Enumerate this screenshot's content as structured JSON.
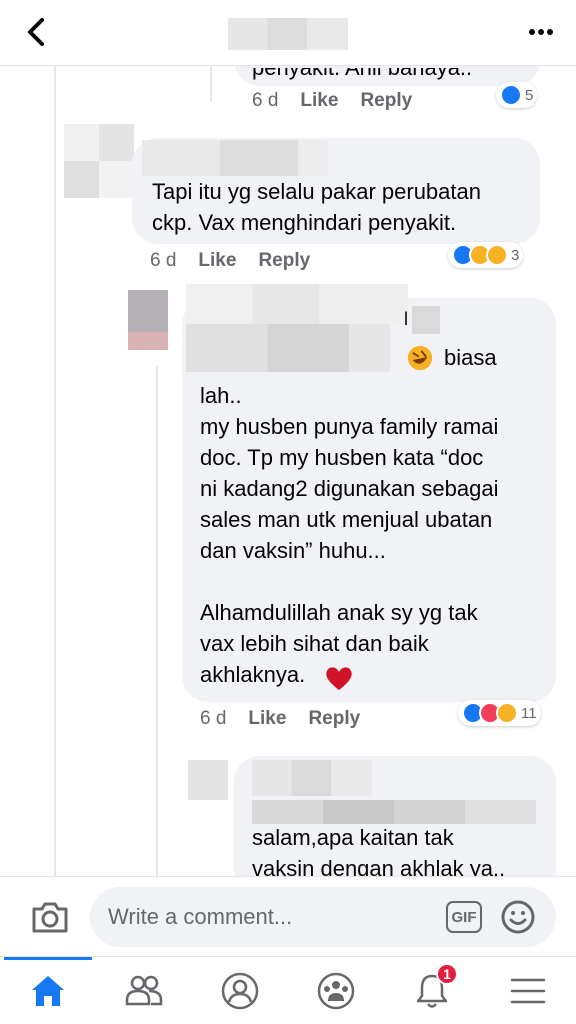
{
  "comments": [
    {
      "text_partial": "penyakit. Ahli bahaya..",
      "time": "6 d",
      "like_label": "Like",
      "reply_label": "Reply",
      "reactions": [
        "like"
      ],
      "reaction_count": "5"
    },
    {
      "text": "Tapi itu yg selalu pakar perubatan\nckp. Vax menghindari penyakit.",
      "time": "6 d",
      "like_label": "Like",
      "reply_label": "Reply",
      "reactions": [
        "like",
        "haha",
        "wow"
      ],
      "reaction_count": "3"
    },
    {
      "name_tail": "l",
      "text_first": "biasa",
      "text": "lah..\nmy husben punya family ramai\ndoc. Tp my husben kata “doc\nni kadang2 digunakan sebagai\nsales man utk menjual ubatan\ndan vaksin” huhu...\n\nAlhamdulillah anak sy yg tak\nvax lebih sihat dan baik\nakhlaknya.",
      "emoji_first": "rolling-on-floor-laughing",
      "emoji_last": "red-heart",
      "time": "6 d",
      "like_label": "Like",
      "reply_label": "Reply",
      "reactions": [
        "like",
        "love",
        "haha"
      ],
      "reaction_count": "11"
    },
    {
      "text": "salam,apa kaitan tak\nvaksin dengan akhlak ya.."
    }
  ],
  "composer": {
    "placeholder": "Write a comment...",
    "gif_label": "GIF",
    "icons": [
      "camera-icon",
      "smiley-icon"
    ]
  },
  "tabbar": {
    "items": [
      "home-icon",
      "friends-icon",
      "profile-icon",
      "groups-icon",
      "notifications-icon",
      "menu-icon"
    ],
    "active": "home-icon",
    "notification_badge": "1"
  },
  "colors": {
    "accent": "#1877f2",
    "bubble": "#f0f2f5",
    "meta": "#65676b",
    "badge": "#e41e3f"
  }
}
